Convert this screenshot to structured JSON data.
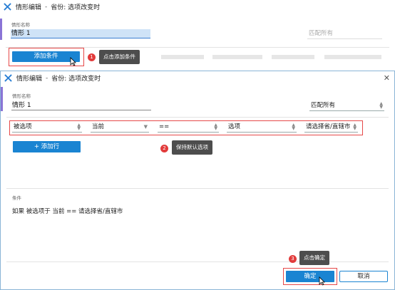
{
  "back_window": {
    "app_title": "情形编辑",
    "subtitle": "省份: 选项改变时",
    "scenario_label": "情形名称",
    "scenario_value": "情形 1",
    "match_placeholder": "匹配所有",
    "add_condition_button": "添加条件"
  },
  "front_window": {
    "app_title": "情形编辑",
    "subtitle": "省份: 选项改变时",
    "scenario_label": "情形名称",
    "scenario_value": "情形 1",
    "match_value": "匹配所有",
    "condition_row": {
      "field": "被选项",
      "scope": "当前",
      "operator": "==",
      "value_type": "选项",
      "value": "请选择省/直辖市"
    },
    "add_row_button": "+ 添加行",
    "conditions_label": "条件",
    "condition_text": "如果  被选项于 当前 == 请选择省/直辖市",
    "confirm_button": "确定",
    "cancel_button": "取消"
  },
  "annotations": [
    {
      "number": "1",
      "text": "点击添加条件"
    },
    {
      "number": "2",
      "text": "保持默认选项"
    },
    {
      "number": "3",
      "text": "点击确定"
    }
  ],
  "colors": {
    "accent": "#1a84d2",
    "annotation_red": "#e23b3b",
    "tooltip_bg": "#4d4d4d",
    "side_bar": "#8a74d6"
  }
}
